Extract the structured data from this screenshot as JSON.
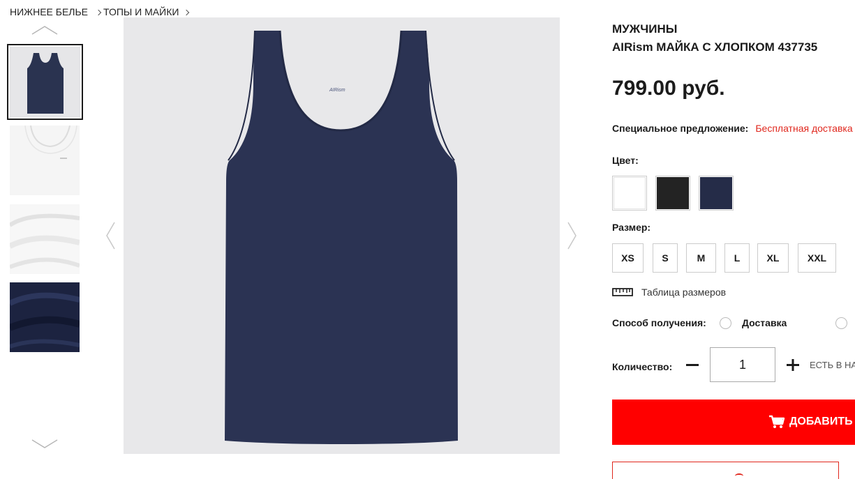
{
  "breadcrumb": {
    "items": [
      "НИЖНЕЕ БЕЛЬЕ",
      "ТОПЫ И МАЙКИ"
    ]
  },
  "gallery": {
    "thumbnails": [
      {
        "alt": "navy tank top",
        "color": "#2a3350",
        "selected": true
      },
      {
        "alt": "white tank top",
        "color": "#f4f4f4",
        "selected": false
      },
      {
        "alt": "white fabric",
        "color": "#f6f6f6",
        "selected": false
      },
      {
        "alt": "navy fabric",
        "color": "#1c2340",
        "selected": false
      }
    ],
    "main_image": {
      "alt": "AIRism tank top navy",
      "garment_color": "#2b3353",
      "background": "#e8e8ea",
      "print_text": "AIRism"
    }
  },
  "product": {
    "gender": "МУЖЧИНЫ",
    "name": "AIRism МАЙКА С ХЛОПКОМ 437735",
    "price": "799.00 руб.",
    "special_offer_label": "Специальное предложение:",
    "special_offer_value": "Бесплатная доставка"
  },
  "color": {
    "label": "Цвет:",
    "options": [
      {
        "name": "white",
        "hex": "#ffffff"
      },
      {
        "name": "black",
        "hex": "#232323"
      },
      {
        "name": "navy",
        "hex": "#252c48"
      }
    ]
  },
  "size": {
    "label": "Размер:",
    "options": [
      "XS",
      "S",
      "M",
      "L",
      "XL",
      "XXL"
    ],
    "chart_label": "Таблица размеров"
  },
  "delivery": {
    "label": "Способ получения:",
    "options": [
      "Доставка"
    ]
  },
  "quantity": {
    "label": "Количество:",
    "value": "1",
    "stock_text": "ЕСТЬ В НАЛИЧИИ"
  },
  "cart": {
    "add_label": "ДОБАВИТЬ В КОРЗИНУ"
  },
  "colors": {
    "accent": "#ff0000",
    "offer_text": "#e0271d",
    "text": "#1b1b1b"
  },
  "icons": [
    "chevron-up-icon",
    "chevron-down-icon",
    "chevron-left-icon",
    "chevron-right-icon",
    "ruler-icon",
    "minus-icon",
    "plus-icon",
    "cart-icon"
  ]
}
